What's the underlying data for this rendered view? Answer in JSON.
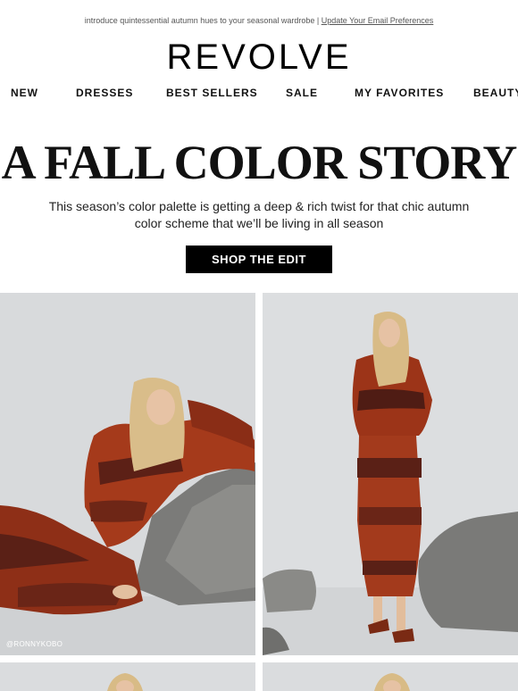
{
  "preheader": {
    "text": "introduce quintessential autumn hues to your seasonal wardrobe |",
    "link": "Update Your Email Preferences"
  },
  "brand": {
    "logo": "REVOLVE"
  },
  "nav": {
    "items": [
      "NEW",
      "DRESSES",
      "BEST SELLERS",
      "SALE",
      "MY FAVORITES",
      "BEAUTY"
    ]
  },
  "hero": {
    "headline": "A FALL COLOR STORY",
    "subcopy": "This season’s color palette is getting a deep & rich twist for that chic autumn color scheme that we’ll be living in all season",
    "cta": "SHOP THE EDIT"
  },
  "photos": {
    "credit": "@RONNYKOBO"
  },
  "colors": {
    "background": "#ffffff",
    "cta_background": "#000000",
    "knit_red": "#9c3418",
    "knit_dark": "#4a1d14",
    "stone": "#7a7a78",
    "studio_grey": "#d9dbdd"
  }
}
